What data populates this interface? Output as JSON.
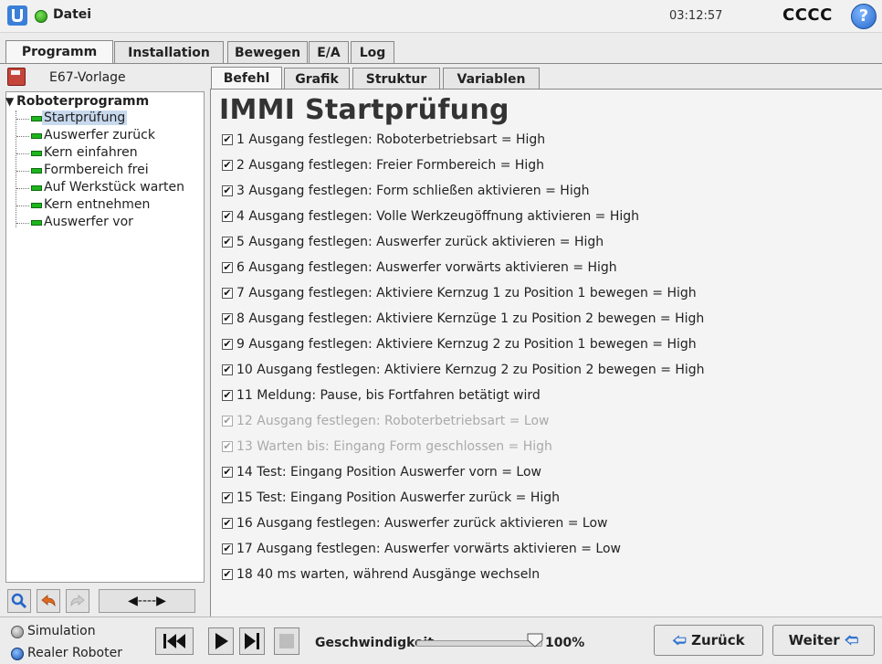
{
  "title_bar": {
    "app_title": "Datei",
    "clock": "03:12:57",
    "robot_name": "CCCC",
    "help_symbol": "?",
    "icons": [
      "ur-logo-icon",
      "status-green-dot-icon",
      "help-icon"
    ]
  },
  "main_tabs": [
    {
      "label": "Programm",
      "active": true
    },
    {
      "label": "Installation",
      "active": false
    },
    {
      "label": "Bewegen",
      "active": false
    },
    {
      "label": "E/A",
      "active": false
    },
    {
      "label": "Log",
      "active": false
    }
  ],
  "file": {
    "name": "E67-Vorlage",
    "icon": "save-icon"
  },
  "tree": {
    "root": "Roboterprogramm",
    "items": [
      {
        "label": "Startprüfung",
        "selected": true
      },
      {
        "label": "Auswerfer zurück",
        "selected": false
      },
      {
        "label": "Kern einfahren",
        "selected": false
      },
      {
        "label": "Formbereich frei",
        "selected": false
      },
      {
        "label": "Auf Werkstück warten",
        "selected": false
      },
      {
        "label": "Kern entnehmen",
        "selected": false
      },
      {
        "label": "Auswerfer vor",
        "selected": false
      }
    ]
  },
  "tree_tools": {
    "icons": [
      "search-icon",
      "undo-icon",
      "redo-icon"
    ],
    "nav_arrows": "◀----▶"
  },
  "sub_tabs": [
    {
      "label": "Befehl",
      "active": true
    },
    {
      "label": "Grafik",
      "active": false
    },
    {
      "label": "Struktur",
      "active": false
    },
    {
      "label": "Variablen",
      "active": false
    }
  ],
  "node": {
    "title": "IMMI Startprüfung",
    "lines": [
      {
        "text": "1 Ausgang festlegen: Roboterbetriebsart = High",
        "checked": true,
        "enabled": true
      },
      {
        "text": "2 Ausgang festlegen: Freier Formbereich = High",
        "checked": true,
        "enabled": true
      },
      {
        "text": "3 Ausgang festlegen: Form schließen aktivieren = High",
        "checked": true,
        "enabled": true
      },
      {
        "text": "4 Ausgang festlegen: Volle Werkzeugöffnung aktivieren = High",
        "checked": true,
        "enabled": true
      },
      {
        "text": "5 Ausgang festlegen: Auswerfer zurück aktivieren = High",
        "checked": true,
        "enabled": true
      },
      {
        "text": "6 Ausgang festlegen: Auswerfer vorwärts aktivieren = High",
        "checked": true,
        "enabled": true
      },
      {
        "text": "7 Ausgang festlegen: Aktiviere Kernzug 1 zu Position 1 bewegen = High",
        "checked": true,
        "enabled": true
      },
      {
        "text": "8 Ausgang festlegen: Aktiviere Kernzüge 1 zu Position 2 bewegen = High",
        "checked": true,
        "enabled": true
      },
      {
        "text": "9 Ausgang festlegen: Aktiviere Kernzug 2 zu Position 1 bewegen = High",
        "checked": true,
        "enabled": true
      },
      {
        "text": "10 Ausgang festlegen: Aktiviere Kernzug 2 zu Position 2 bewegen = High",
        "checked": true,
        "enabled": true
      },
      {
        "text": "11 Meldung: Pause, bis Fortfahren betätigt wird",
        "checked": true,
        "enabled": true
      },
      {
        "text": "12 Ausgang festlegen: Roboterbetriebsart = Low",
        "checked": true,
        "enabled": false
      },
      {
        "text": "13 Warten bis: Eingang Form geschlossen = High",
        "checked": true,
        "enabled": false
      },
      {
        "text": "14 Test: Eingang Position Auswerfer vorn = Low",
        "checked": true,
        "enabled": true
      },
      {
        "text": "15 Test: Eingang Position Auswerfer zurück = High",
        "checked": true,
        "enabled": true
      },
      {
        "text": "16 Ausgang festlegen: Auswerfer zurück aktivieren = Low",
        "checked": true,
        "enabled": true
      },
      {
        "text": "17 Ausgang festlegen: Auswerfer vorwärts aktivieren = Low",
        "checked": true,
        "enabled": true
      },
      {
        "text": "18 40 ms warten, während Ausgänge wechseln",
        "checked": true,
        "enabled": true
      }
    ]
  },
  "bottom": {
    "simulation_label": "Simulation",
    "real_robot_label": "Realer Roboter",
    "speed_label": "Geschwindigkeit",
    "speed_value": "100%",
    "speed_fraction": 1.0,
    "back_label": "Zurück",
    "next_label": "Weiter",
    "playback_icons": [
      "skip-to-start-icon",
      "play-icon",
      "step-icon",
      "stop-icon"
    ]
  },
  "colors": {
    "status_green": "#1db51d",
    "accent_blue": "#2466c9",
    "nav_arrow_blue": "#2f74d0"
  }
}
